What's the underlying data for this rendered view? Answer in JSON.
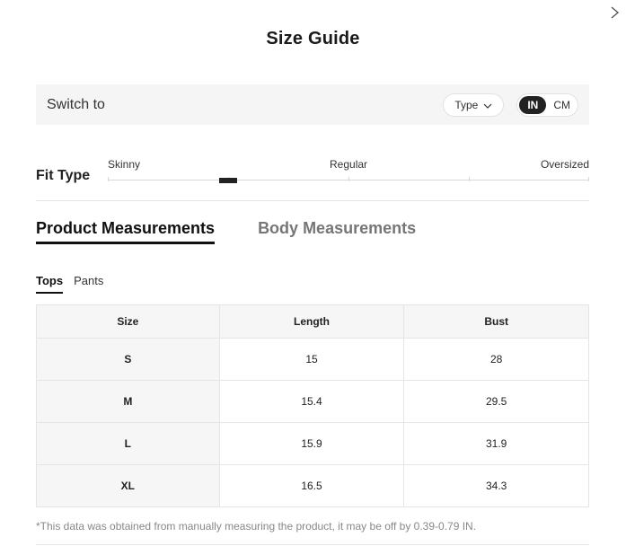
{
  "title": "Size Guide",
  "switch_bar": {
    "label": "Switch to",
    "type_select": "Type",
    "units": [
      {
        "label": "IN",
        "active": true
      },
      {
        "label": "CM",
        "active": false
      }
    ]
  },
  "fit_type": {
    "label": "Fit Type",
    "scale": [
      "Skinny",
      "Regular",
      "Oversized"
    ],
    "selected_position": 0.25
  },
  "measurement_tabs": [
    {
      "label": "Product Measurements",
      "active": true
    },
    {
      "label": "Body Measurements",
      "active": false
    }
  ],
  "sub_tabs": [
    {
      "label": "Tops",
      "active": true
    },
    {
      "label": "Pants",
      "active": false
    }
  ],
  "table": {
    "headers": [
      "Size",
      "Length",
      "Bust"
    ],
    "rows": [
      [
        "S",
        "15",
        "28"
      ],
      [
        "M",
        "15.4",
        "29.5"
      ],
      [
        "L",
        "15.9",
        "31.9"
      ],
      [
        "XL",
        "16.5",
        "34.3"
      ]
    ]
  },
  "footnote": "*This data was obtained from manually measuring the product, it may be off by 0.39-0.79 IN.",
  "colors": {
    "accent": "#222222",
    "panel_bg": "#f5f5f5",
    "muted_text": "#767676"
  },
  "icons": {
    "close": "close-icon",
    "chevron": "chevron-down-icon"
  }
}
